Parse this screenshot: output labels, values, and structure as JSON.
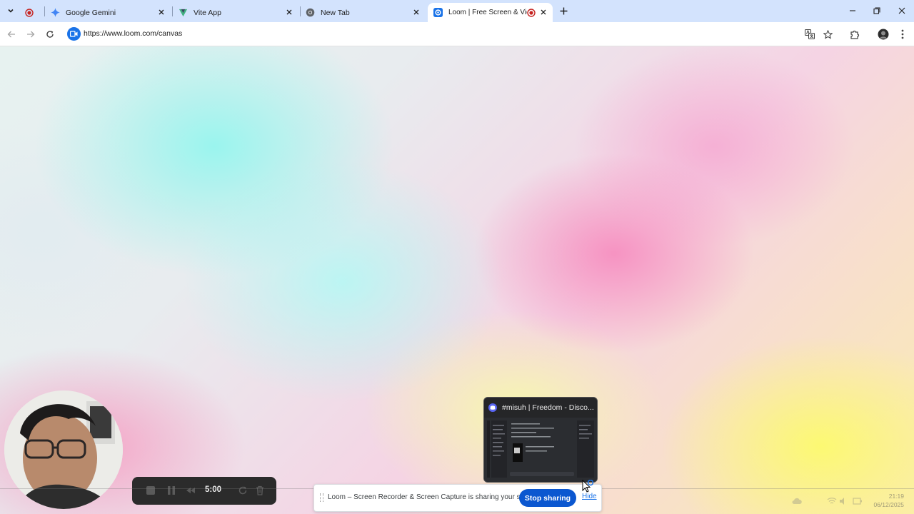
{
  "browser": {
    "tabs": [
      {
        "title": "",
        "icon": "recording-dot-icon",
        "active": false
      },
      {
        "title": "Google Gemini",
        "icon": "gemini-icon",
        "active": false
      },
      {
        "title": "Vite App",
        "icon": "vite-icon",
        "active": false
      },
      {
        "title": "New Tab",
        "icon": "chrome-icon",
        "active": false
      },
      {
        "title": "Loom | Free Screen & Video",
        "icon": "loom-icon",
        "active": true
      }
    ],
    "url": "https://www.loom.com/canvas",
    "accent": "#d3e3fd"
  },
  "loom": {
    "timer": "5:00",
    "preview_title": "#misuh | Freedom - Disco...",
    "share_message": "Loom – Screen Recorder & Screen Capture is sharing your screen.",
    "stop_label": "Stop sharing",
    "hide_label": "Hide",
    "stop_color": "#0b57d0"
  },
  "taskbar": {
    "time": "21:19",
    "date": "06/12/2025"
  }
}
